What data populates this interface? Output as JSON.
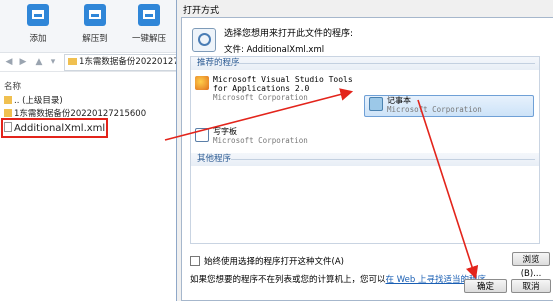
{
  "file_manager": {
    "toolbar": [
      {
        "label": "添加",
        "icon": "add-icon"
      },
      {
        "label": "解压到",
        "icon": "extract-icon"
      },
      {
        "label": "一键解压",
        "icon": "one-click-extract-icon"
      }
    ],
    "path": "1东需数据备份20220127",
    "column_header": "名称",
    "rows": [
      {
        "label": ".. (上级目录)",
        "icon": "folder-up-icon"
      },
      {
        "label": "1东需数据备份20220127215600",
        "icon": "folder-icon"
      },
      {
        "label": "AdditionalXml.xml",
        "icon": "file-icon"
      }
    ]
  },
  "dialog": {
    "title": "打开方式",
    "instruction": "选择您想用来打开此文件的程序:",
    "file_label": "文件:",
    "file_name": "AdditionalXml.xml",
    "recommended_header": "推荐的程序",
    "programs": [
      {
        "name_line1": "Microsoft Visual Studio Tools",
        "name_line2": "for Applications 2.0",
        "company": "Microsoft Corporation",
        "icon": "vs-tools-icon"
      },
      {
        "name": "记事本",
        "company": "Microsoft Corporation",
        "icon": "notepad-icon"
      },
      {
        "name": "写字板",
        "company": "Microsoft Corporation",
        "icon": "wordpad-icon"
      }
    ],
    "other_header": "其他程序",
    "always_use_label": "始终使用选择的程序打开这种文件(A)",
    "browse_label": "浏览(B)...",
    "note_prefix": "如果您想要的程序不在列表或您的计算机上，您可以",
    "note_link": "在 Web 上寻找适当的程序",
    "note_suffix": "。",
    "ok_label": "确定",
    "cancel_label": "取消"
  },
  "colors": {
    "highlight_red": "#e3241b",
    "accent_blue": "#2f86d8"
  }
}
